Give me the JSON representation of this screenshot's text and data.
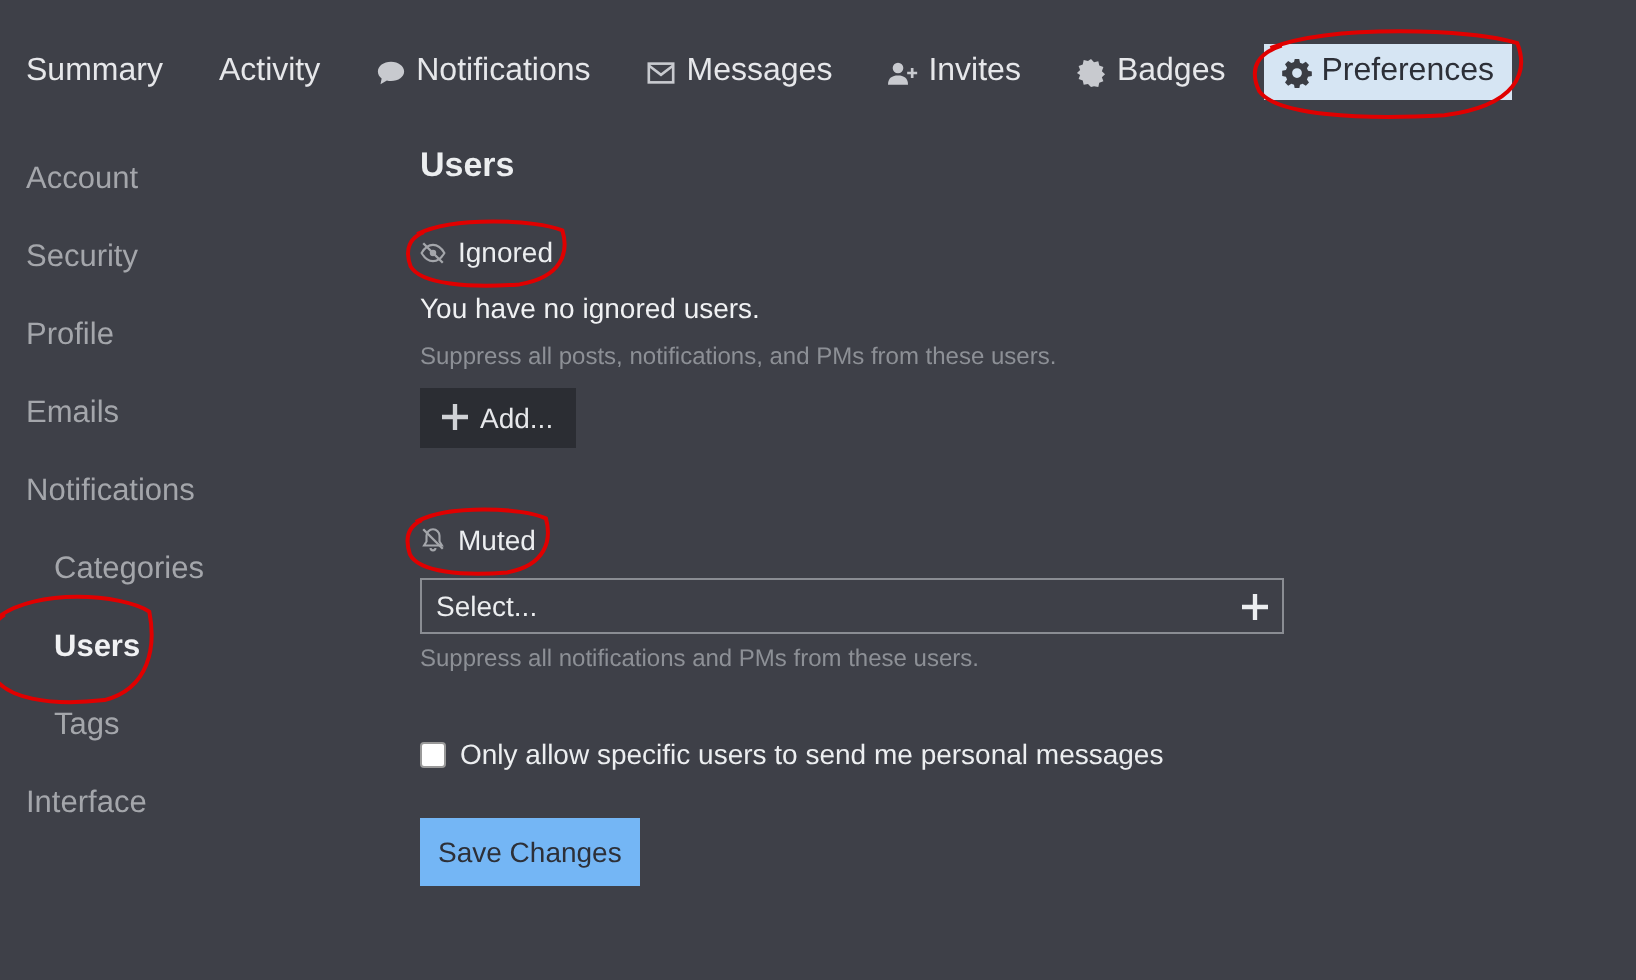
{
  "tabs": [
    {
      "label": "Summary",
      "kind": "plain",
      "selected": false,
      "annotated": false
    },
    {
      "label": "Activity",
      "kind": "plain",
      "selected": false,
      "annotated": false
    },
    {
      "label": "Notifications",
      "kind": "comment",
      "selected": false,
      "annotated": false
    },
    {
      "label": "Messages",
      "kind": "envelope",
      "selected": false,
      "annotated": false
    },
    {
      "label": "Invites",
      "kind": "user",
      "selected": false,
      "annotated": false
    },
    {
      "label": "Badges",
      "kind": "badge",
      "selected": false,
      "annotated": false
    },
    {
      "label": "Preferences",
      "kind": "gear",
      "selected": true,
      "annotated": true
    }
  ],
  "sidebar": {
    "items": [
      {
        "label": "Account",
        "selected": false,
        "annotated": false
      },
      {
        "label": "Security",
        "selected": false,
        "annotated": false
      },
      {
        "label": "Profile",
        "selected": false,
        "annotated": false
      },
      {
        "label": "Emails",
        "selected": false,
        "annotated": false
      },
      {
        "label": "Notifications",
        "selected": false,
        "annotated": false,
        "children": [
          {
            "label": "Categories",
            "selected": false,
            "annotated": false
          },
          {
            "label": "Users",
            "selected": true,
            "annotated": true
          },
          {
            "label": "Tags",
            "selected": false,
            "annotated": false
          }
        ]
      },
      {
        "label": "Interface",
        "selected": false,
        "annotated": false
      }
    ]
  },
  "content": {
    "title": "Users",
    "ignored": {
      "label": "Ignored",
      "annotated": true,
      "empty_text": "You have no ignored users.",
      "help": "Suppress all posts, notifications, and PMs from these users.",
      "button": "Add..."
    },
    "muted": {
      "label": "Muted",
      "annotated": true,
      "placeholder": "Select...",
      "help": "Suppress all notifications and PMs from these users."
    },
    "allow_pm": {
      "label": "Only allow specific users to send me personal messages",
      "checked": false
    },
    "save_button": "Save Changes"
  }
}
